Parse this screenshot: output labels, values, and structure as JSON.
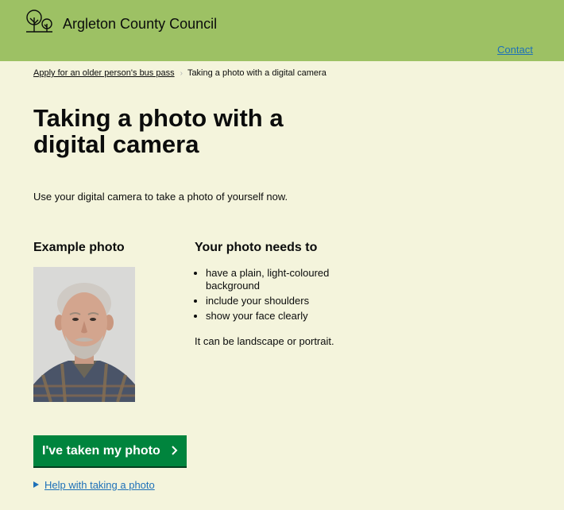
{
  "header": {
    "council_name": "Argleton County Council",
    "contact_link": "Contact",
    "logo_icon": "trees-icon",
    "background_color": "#9dc164"
  },
  "breadcrumb": {
    "parent": "Apply for an older person's bus pass",
    "current": "Taking a photo with a digital camera"
  },
  "main": {
    "title": "Taking a photo with a digital camera",
    "intro": "Use your digital camera to take a photo of yourself now.",
    "example": {
      "heading": "Example photo",
      "image_alt": "example-photo"
    },
    "requirements": {
      "heading": "Your photo needs to",
      "items": [
        "have a plain, light-coloured background",
        "include your shoulders",
        "show your face clearly"
      ],
      "note": "It can be landscape or portrait."
    },
    "primary_button": "I've taken my photo",
    "help_link": "Help with taking a photo"
  },
  "colors": {
    "page_background": "#f4f4dc",
    "button": "#00843d",
    "link": "#1d70b8"
  }
}
